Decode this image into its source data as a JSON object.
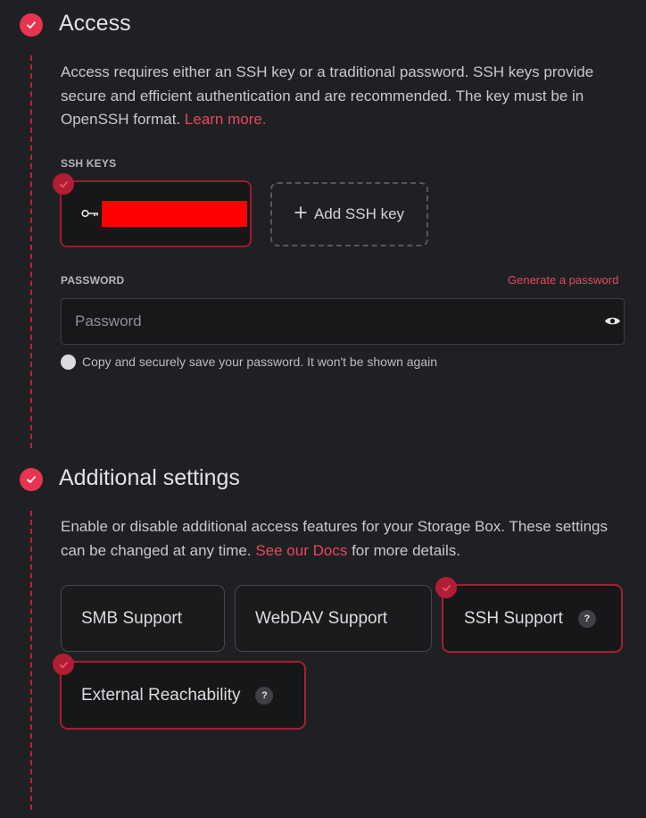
{
  "access": {
    "title": "Access",
    "description": "Access requires either an SSH key or a traditional password. SSH keys provide secure and efficient authentication and are recommended. The key must be in OpenSSH format.",
    "learn_more": "Learn more.",
    "ssh_keys_label": "SSH KEYS",
    "add_ssh_key": "Add SSH key",
    "password_label": "PASSWORD",
    "generate_password": "Generate a password",
    "password_placeholder": "Password",
    "password_value": "",
    "save_notice": "Copy and securely save your password. It won't be shown again"
  },
  "additional": {
    "title": "Additional settings",
    "description": "Enable or disable additional access features for your Storage Box. These settings can be changed at any time.",
    "docs_link": "See our Docs",
    "description_tail": "for more details.",
    "options": {
      "smb": {
        "label": "SMB Support",
        "selected": false
      },
      "webdav": {
        "label": "WebDAV Support",
        "selected": false
      },
      "ssh": {
        "label": "SSH Support",
        "selected": true,
        "help": "?"
      },
      "external": {
        "label": "External Reachability",
        "selected": true,
        "help": "?"
      }
    }
  },
  "colors": {
    "accent": "#e8344e",
    "redacted": "#ff0000",
    "background": "#1f2023"
  },
  "icons": {
    "step_complete": "check-icon",
    "ssh_key": "key-icon",
    "add": "plus-icon",
    "reveal_password": "eye-icon",
    "notice": "circle-icon",
    "help": "help-icon"
  }
}
